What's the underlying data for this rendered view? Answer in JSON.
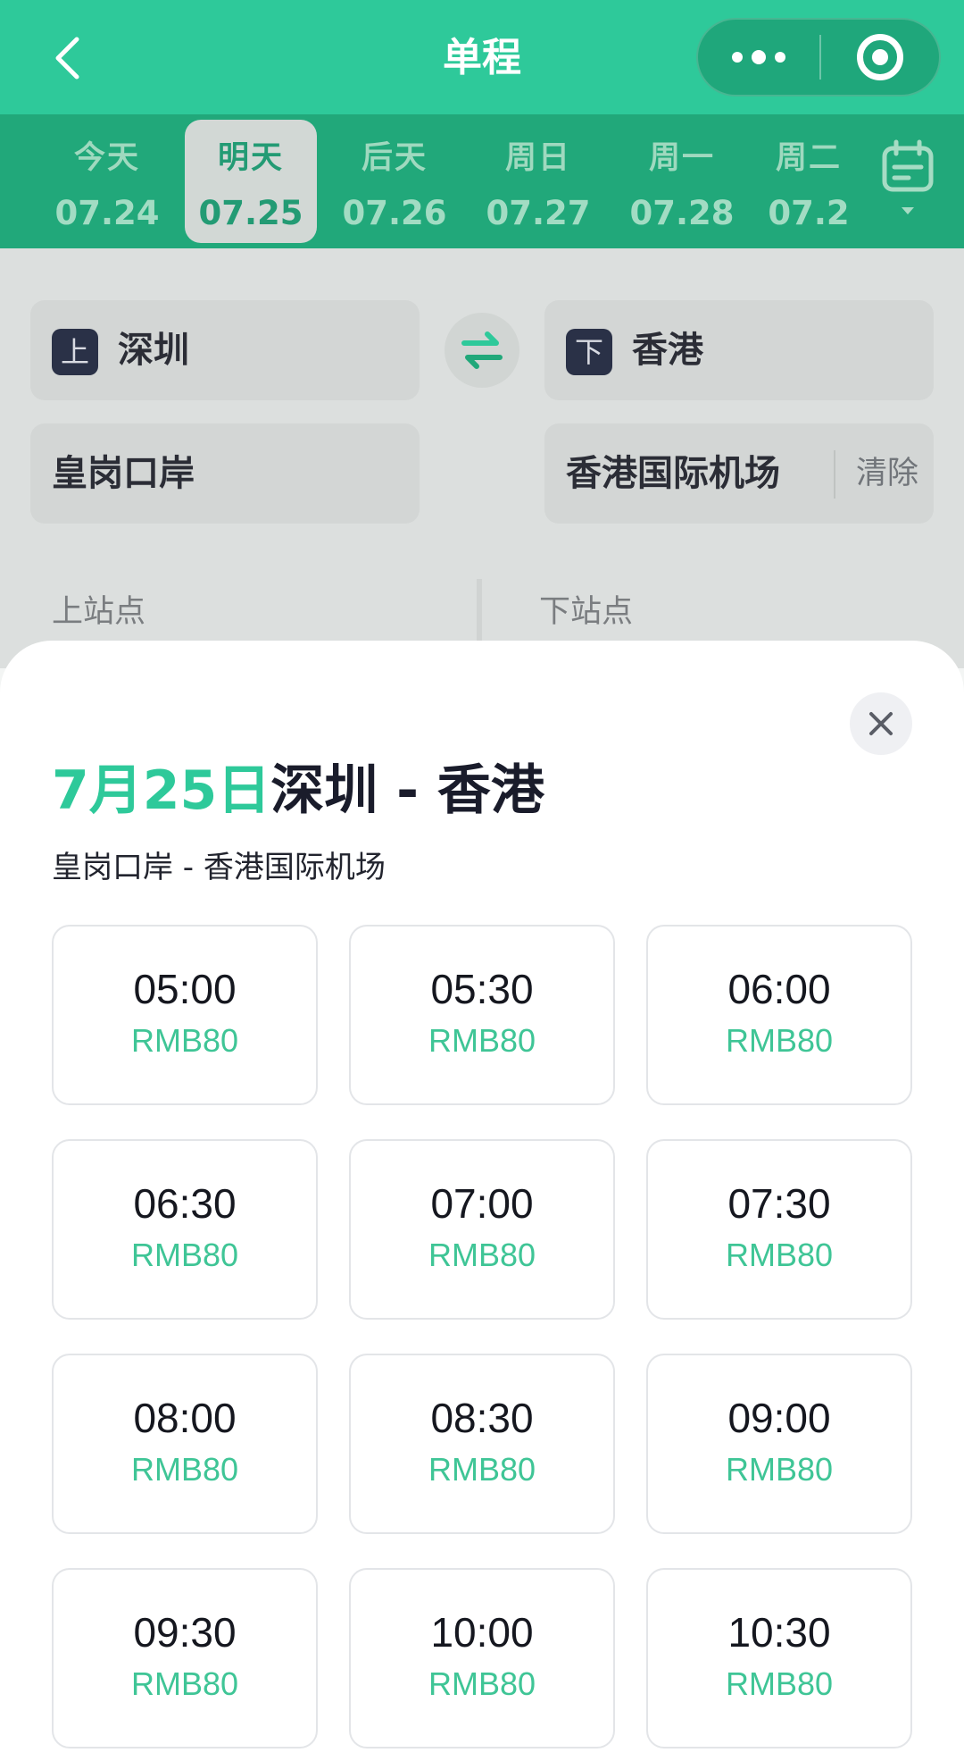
{
  "header": {
    "title": "单程"
  },
  "dates": [
    {
      "day": "今天",
      "date": "07.24",
      "active": false
    },
    {
      "day": "明天",
      "date": "07.25",
      "active": true
    },
    {
      "day": "后天",
      "date": "07.26",
      "active": false
    },
    {
      "day": "周日",
      "date": "07.27",
      "active": false
    },
    {
      "day": "周一",
      "date": "07.28",
      "active": false
    },
    {
      "day": "周二",
      "date": "07.2",
      "active": false
    }
  ],
  "form": {
    "from_tag": "上",
    "from_city": "深圳",
    "to_tag": "下",
    "to_city": "香港",
    "from_station": "皇岗口岸",
    "to_station": "香港国际机场",
    "clear_label": "清除",
    "board_label": "上站点",
    "alight_label": "下站点"
  },
  "sheet": {
    "date": "7月25日",
    "route": "深圳 - 香港",
    "subtitle": "皇岗口岸 - 香港国际机场",
    "slots": [
      {
        "time": "05:00",
        "price": "RMB80"
      },
      {
        "time": "05:30",
        "price": "RMB80"
      },
      {
        "time": "06:00",
        "price": "RMB80"
      },
      {
        "time": "06:30",
        "price": "RMB80"
      },
      {
        "time": "07:00",
        "price": "RMB80"
      },
      {
        "time": "07:30",
        "price": "RMB80"
      },
      {
        "time": "08:00",
        "price": "RMB80"
      },
      {
        "time": "08:30",
        "price": "RMB80"
      },
      {
        "time": "09:00",
        "price": "RMB80"
      },
      {
        "time": "09:30",
        "price": "RMB80"
      },
      {
        "time": "10:00",
        "price": "RMB80"
      },
      {
        "time": "10:30",
        "price": "RMB80"
      }
    ]
  },
  "colors": {
    "header": "#2ec99a",
    "datebar": "#21a87a",
    "accent": "#2ec99a",
    "price": "#3fc596"
  }
}
